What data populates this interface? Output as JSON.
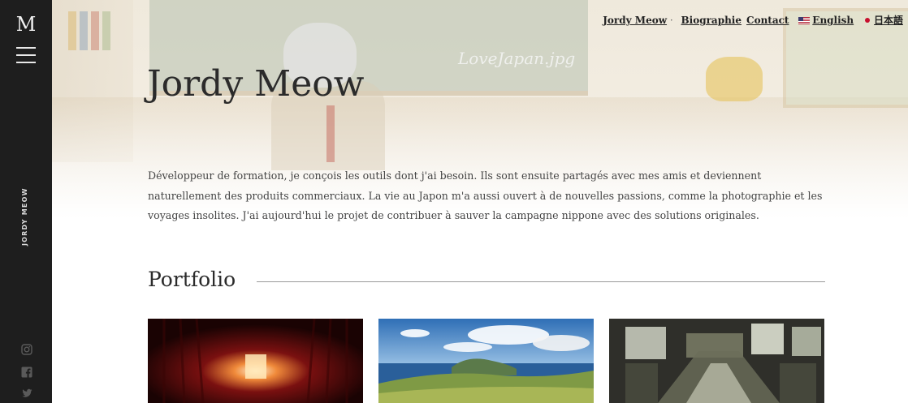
{
  "sidebar": {
    "logo": "M",
    "vertical_label": "JORDY MEOW",
    "social_icons": [
      "instagram-icon",
      "facebook-icon",
      "twitter-icon"
    ]
  },
  "hero": {
    "chalkboard_text": "LoveJapan.jpg"
  },
  "nav": {
    "items": [
      {
        "label": "Jordy Meow"
      },
      {
        "label": "Biographie"
      },
      {
        "label": "Contact"
      },
      {
        "label": "English",
        "flag": "us-flag-icon"
      },
      {
        "label": "日本語",
        "flag": "japan-flag-icon"
      }
    ]
  },
  "page": {
    "title": "Jordy Meow",
    "intro": "Développeur de formation, je conçois les outils dont j'ai besoin. Ils sont ensuite partagés avec mes amis et deviennent naturellement des produits commerciaux. La vie au Japon m'a aussi ouvert à de nouvelles passions, comme la photographie et les voyages insolites. J'ai aujourd'hui le projet de contribuer à sauver la campagne nippone avec des solutions originales.",
    "portfolio_title": "Portfolio"
  },
  "colors": {
    "sidebar_bg": "#1e1e1e",
    "text": "#2b2b2b",
    "japan_red": "#c8102e"
  }
}
